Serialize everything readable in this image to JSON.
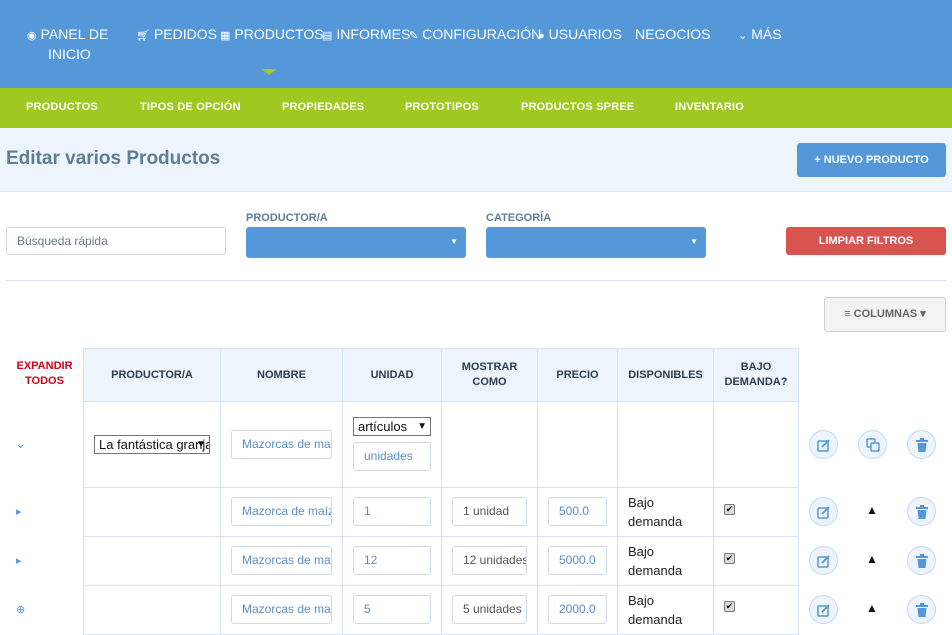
{
  "topnav": {
    "items": [
      {
        "label_1": "PANEL DE",
        "label_2": "INICIO",
        "icon": "dashboard-icon"
      },
      {
        "label": "PEDIDOS",
        "icon": "cart-icon"
      },
      {
        "label": "PRODUCTOS",
        "icon": "grid-icon"
      },
      {
        "label": "INFORMES",
        "icon": "file-icon"
      },
      {
        "label": "CONFIGURACIÓN",
        "icon": "wrench-icon"
      },
      {
        "label": "USUARIOS",
        "icon": "user-icon"
      },
      {
        "label": "NEGOCIOS"
      },
      {
        "label": "MÁS",
        "icon": "chevron-down-icon"
      }
    ]
  },
  "subnav": {
    "items": [
      "PRODUCTOS",
      "TIPOS DE OPCIÓN",
      "PROPIEDADES",
      "PROTOTIPOS",
      "PRODUCTOS SPREE",
      "INVENTARIO"
    ]
  },
  "header": {
    "title": "Editar varios Productos",
    "new_button": "NUEVO PRODUCTO"
  },
  "filters": {
    "quick_search_placeholder": "Búsqueda rápida",
    "producer_label": "PRODUCTOR/A",
    "category_label": "CATEGORÍA",
    "clear_button": "LIMPIAR FILTROS",
    "columns_button": "COLUMNAS"
  },
  "table": {
    "expand_all_1": "EXPANDIR",
    "expand_all_2": "TODOS",
    "headers": [
      "PRODUCTOR/A",
      "NOMBRE",
      "UNIDAD",
      "MOSTRAR COMO",
      "PRECIO",
      "DISPONIBLES",
      "BAJO DEMANDA?"
    ],
    "product": {
      "producer": "La fantástica granja",
      "name": "Mazorcas de maíz",
      "unit_type": "artículos",
      "unit_name": "unidades"
    },
    "variants": [
      {
        "name": "Mazorca de maíz",
        "unit": "1",
        "display_as": "1 unidad",
        "price": "500.0",
        "available_1": "Bajo",
        "available_2": "demanda",
        "on_demand": true
      },
      {
        "name": "Mazorcas de maíz",
        "unit": "12",
        "display_as": "12 unidades",
        "price": "5000.0",
        "available_1": "Bajo",
        "available_2": "demanda",
        "on_demand": true
      },
      {
        "name": "Mazorcas de maíz",
        "unit": "5",
        "display_as": "5 unidades",
        "price": "2000.0",
        "available_1": "Bajo",
        "available_2": "demanda",
        "on_demand": true
      }
    ]
  }
}
